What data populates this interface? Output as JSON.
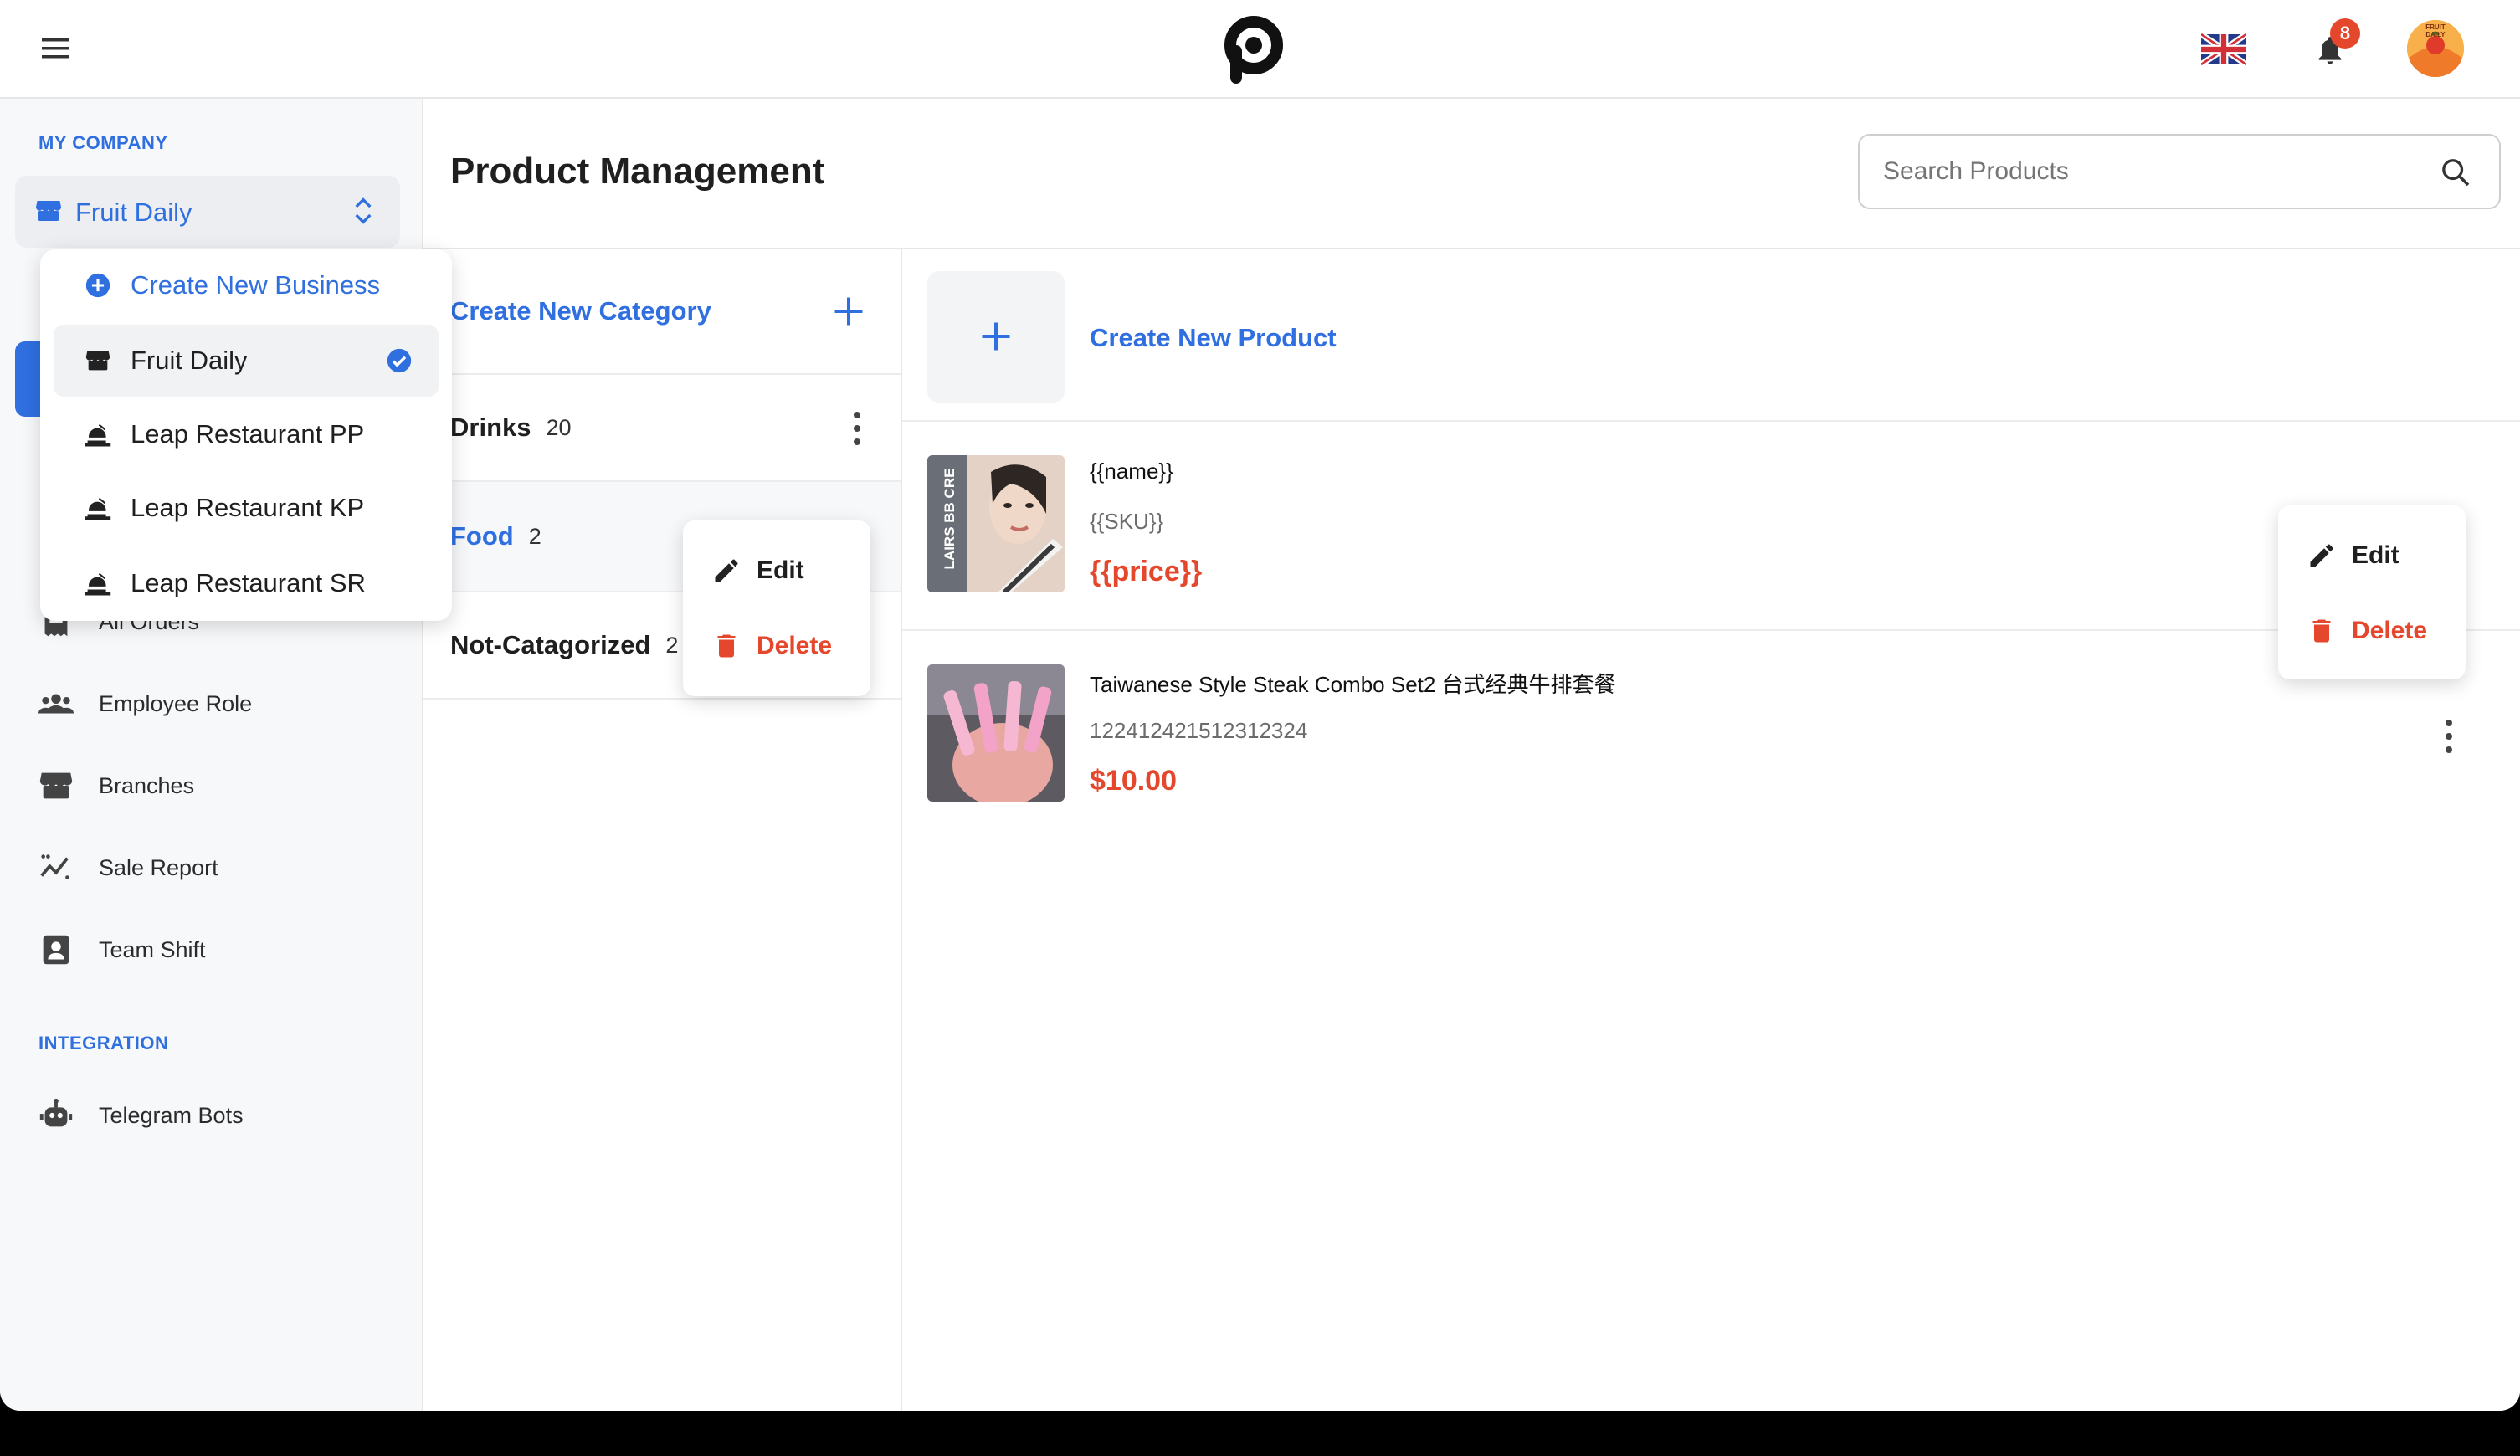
{
  "header": {
    "notification_count": "8",
    "avatar_text": "FRUIT DAILY"
  },
  "sidebar": {
    "section_company": "MY COMPANY",
    "current_business": "Fruit Daily",
    "items": [
      {
        "label": "All Orders",
        "icon": "receipt-icon"
      },
      {
        "label": "Employee Role",
        "icon": "group-icon"
      },
      {
        "label": "Branches",
        "icon": "store-icon"
      },
      {
        "label": "Sale Report",
        "icon": "chart-icon"
      },
      {
        "label": "Team Shift",
        "icon": "badge-icon"
      }
    ],
    "section_integration": "INTEGRATION",
    "integration_items": [
      {
        "label": "Telegram Bots",
        "icon": "robot-icon"
      }
    ]
  },
  "business_dropdown": {
    "create_label": "Create New Business",
    "options": [
      {
        "label": "Fruit Daily",
        "selected": true
      },
      {
        "label": "Leap Restaurant PP",
        "selected": false
      },
      {
        "label": "Leap Restaurant KP",
        "selected": false
      },
      {
        "label": "Leap Restaurant SR",
        "selected": false
      }
    ]
  },
  "page": {
    "title": "Product Management",
    "search_placeholder": "Search Products"
  },
  "categories": {
    "create_label": "Create New Category",
    "items": [
      {
        "name": "Drinks",
        "count": "20"
      },
      {
        "name": "Food",
        "count": "2"
      },
      {
        "name": "Not-Catagorized",
        "count": "2"
      }
    ],
    "context_menu": {
      "edit": "Edit",
      "delete": "Delete"
    }
  },
  "products": {
    "create_label": "Create New Product",
    "items": [
      {
        "name": "{{name}}",
        "sku": "{{SKU}}",
        "price": "{{price}}",
        "image_text": "LAIRS BB CRE"
      },
      {
        "name": "Taiwanese Style Steak Combo Set2 台式经典牛排套餐",
        "sku": "122412421512312324",
        "price": "$10.00"
      }
    ],
    "context_menu": {
      "edit": "Edit",
      "delete": "Delete"
    }
  },
  "colors": {
    "accent": "#2f6fe0",
    "danger": "#e5472d",
    "sidebar_bg": "#f7f8fa"
  }
}
